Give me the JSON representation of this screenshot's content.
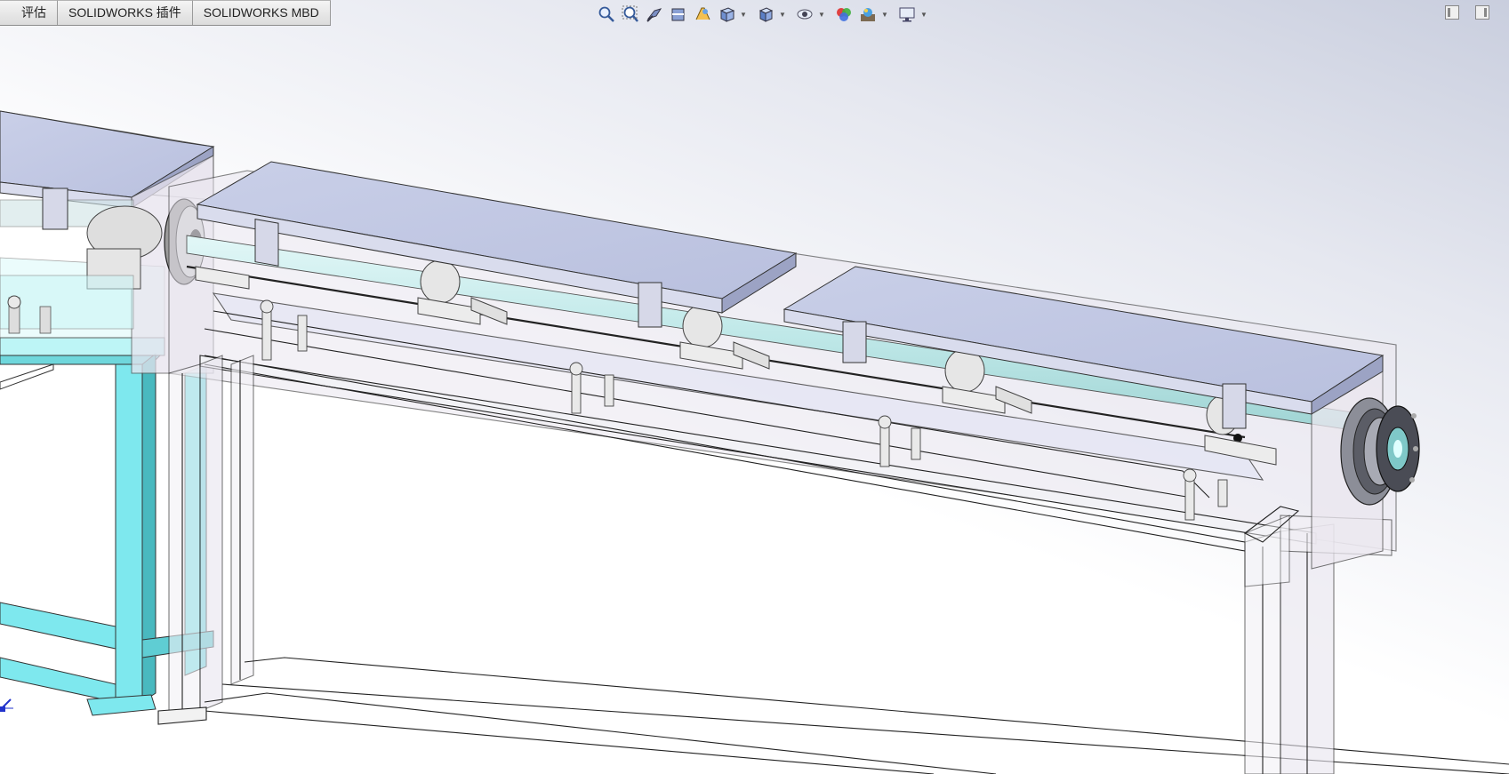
{
  "app": "SOLIDWORKS",
  "command_manager": {
    "tabs": [
      {
        "label": "评估"
      },
      {
        "label": "SOLIDWORKS 插件"
      },
      {
        "label": "SOLIDWORKS MBD"
      }
    ]
  },
  "heads_up_toolbar": {
    "buttons": [
      {
        "icon": "zoom-to-fit-icon"
      },
      {
        "icon": "zoom-to-area-icon"
      },
      {
        "icon": "previous-view-icon"
      },
      {
        "icon": "section-view-icon"
      },
      {
        "icon": "dynamic-annotation-views-icon"
      },
      {
        "icon": "view-orientation-icon",
        "dropdown": true
      },
      {
        "icon": "display-style-icon",
        "dropdown": true
      },
      {
        "icon": "hide-show-items-icon",
        "dropdown": true
      },
      {
        "icon": "edit-appearance-icon"
      },
      {
        "icon": "apply-scene-icon",
        "dropdown": true
      },
      {
        "icon": "view-settings-icon",
        "dropdown": true
      }
    ]
  },
  "window_controls": [
    "collapse-left-icon",
    "collapse-right-icon"
  ],
  "graphics_area": {
    "content": "3D assembly model",
    "colors": {
      "cover": "#c2c8e2",
      "frame_cyan": "#7fe9ee",
      "transparent_body": "#e4e4f0",
      "shaft": "#c8ecec",
      "background_top": "#c9cede"
    }
  },
  "triad": {
    "icon": "reference-triad-icon"
  }
}
